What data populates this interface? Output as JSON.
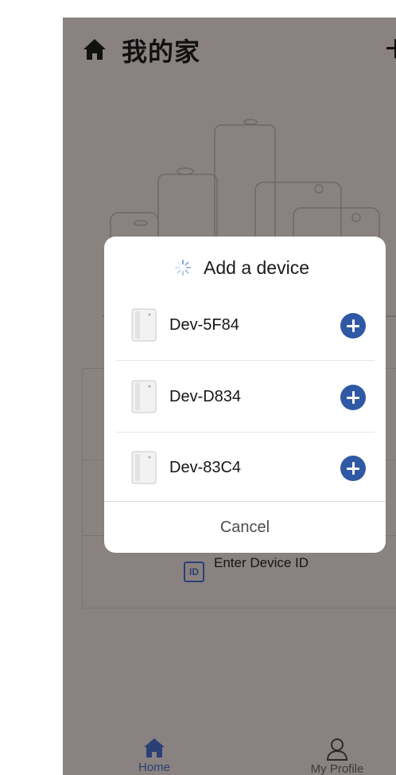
{
  "header": {
    "title": "我的家",
    "home_icon": "home-icon",
    "add_icon": "plus-icon"
  },
  "main": {
    "enter_device_id": {
      "label": "Enter Device ID",
      "icon": "id-card-icon"
    }
  },
  "tabbar": {
    "tabs": [
      {
        "label": "Home",
        "icon": "home-icon",
        "active": true
      },
      {
        "label": "My Profile",
        "icon": "person-icon",
        "active": false
      }
    ]
  },
  "dialog": {
    "title": "Add a device",
    "status_icon": "loading-spinner-icon",
    "devices": [
      {
        "name": "Dev-5F84",
        "icon": "device-unit-icon",
        "action_icon": "plus-circle-icon"
      },
      {
        "name": "Dev-D834",
        "icon": "device-unit-icon",
        "action_icon": "plus-circle-icon"
      },
      {
        "name": "Dev-83C4",
        "icon": "device-unit-icon",
        "action_icon": "plus-circle-icon"
      }
    ],
    "cancel_label": "Cancel"
  },
  "colors": {
    "overlay_background": "#8a8280",
    "accent_blue": "#2f58a5",
    "tab_active": "#2b3f77",
    "dialog_background": "#ffffff"
  }
}
